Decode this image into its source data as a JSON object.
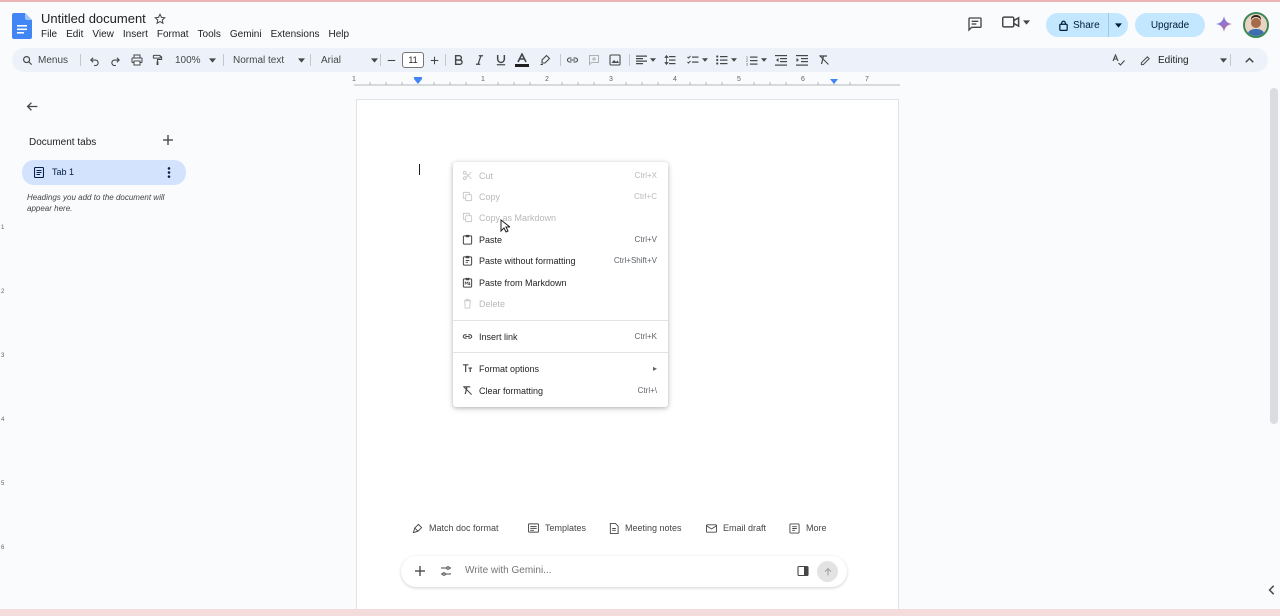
{
  "app": {
    "title": "Untitled document",
    "menus": [
      "File",
      "Edit",
      "View",
      "Insert",
      "Format",
      "Tools",
      "Gemini",
      "Extensions",
      "Help"
    ]
  },
  "header_actions": {
    "share_label": "Share",
    "upgrade_label": "Upgrade"
  },
  "toolbar": {
    "menus_label": "Menus",
    "zoom": "100%",
    "style": "Normal text",
    "font": "Arial",
    "font_size": "11",
    "mode": "Editing"
  },
  "ruler": {
    "h_numbers": [
      "1",
      "1",
      "2",
      "3",
      "4",
      "5",
      "6",
      "7"
    ],
    "v_numbers": [
      "1",
      "2",
      "3",
      "4",
      "5",
      "6"
    ]
  },
  "sidebar": {
    "heading": "Document tabs",
    "tab_label": "Tab 1",
    "hint": "Headings you add to the document will appear here."
  },
  "context_menu": {
    "items": [
      {
        "label": "Cut",
        "shortcut": "Ctrl+X",
        "icon": "scissors-icon",
        "disabled": true
      },
      {
        "label": "Copy",
        "shortcut": "Ctrl+C",
        "icon": "copy-icon",
        "disabled": true
      },
      {
        "label": "Copy as Markdown",
        "shortcut": "",
        "icon": "copy-icon",
        "disabled": true
      },
      {
        "label": "Paste",
        "shortcut": "Ctrl+V",
        "icon": "clipboard-icon",
        "disabled": false
      },
      {
        "label": "Paste without formatting",
        "shortcut": "Ctrl+Shift+V",
        "icon": "clipboard-plain-icon",
        "disabled": false
      },
      {
        "label": "Paste from Markdown",
        "shortcut": "",
        "icon": "clipboard-markdown-icon",
        "disabled": false
      },
      {
        "label": "Delete",
        "shortcut": "",
        "icon": "trash-icon",
        "disabled": true
      },
      {
        "label": "Insert link",
        "shortcut": "Ctrl+K",
        "icon": "link-icon",
        "disabled": false
      },
      {
        "label": "Format options",
        "shortcut": "▸",
        "icon": "text-format-icon",
        "disabled": false
      },
      {
        "label": "Clear formatting",
        "shortcut": "Ctrl+\\",
        "icon": "clear-format-icon",
        "disabled": false
      }
    ]
  },
  "chips": [
    "Match doc format",
    "Templates",
    "Meeting notes",
    "Email draft",
    "More"
  ],
  "gemini": {
    "placeholder": "Write with Gemini..."
  },
  "colors": {
    "accent": "#c2e7ff",
    "tab_active": "#d3e3fd",
    "toolbar_bg": "#edf2fa",
    "docs_blue": "#4285f4"
  }
}
